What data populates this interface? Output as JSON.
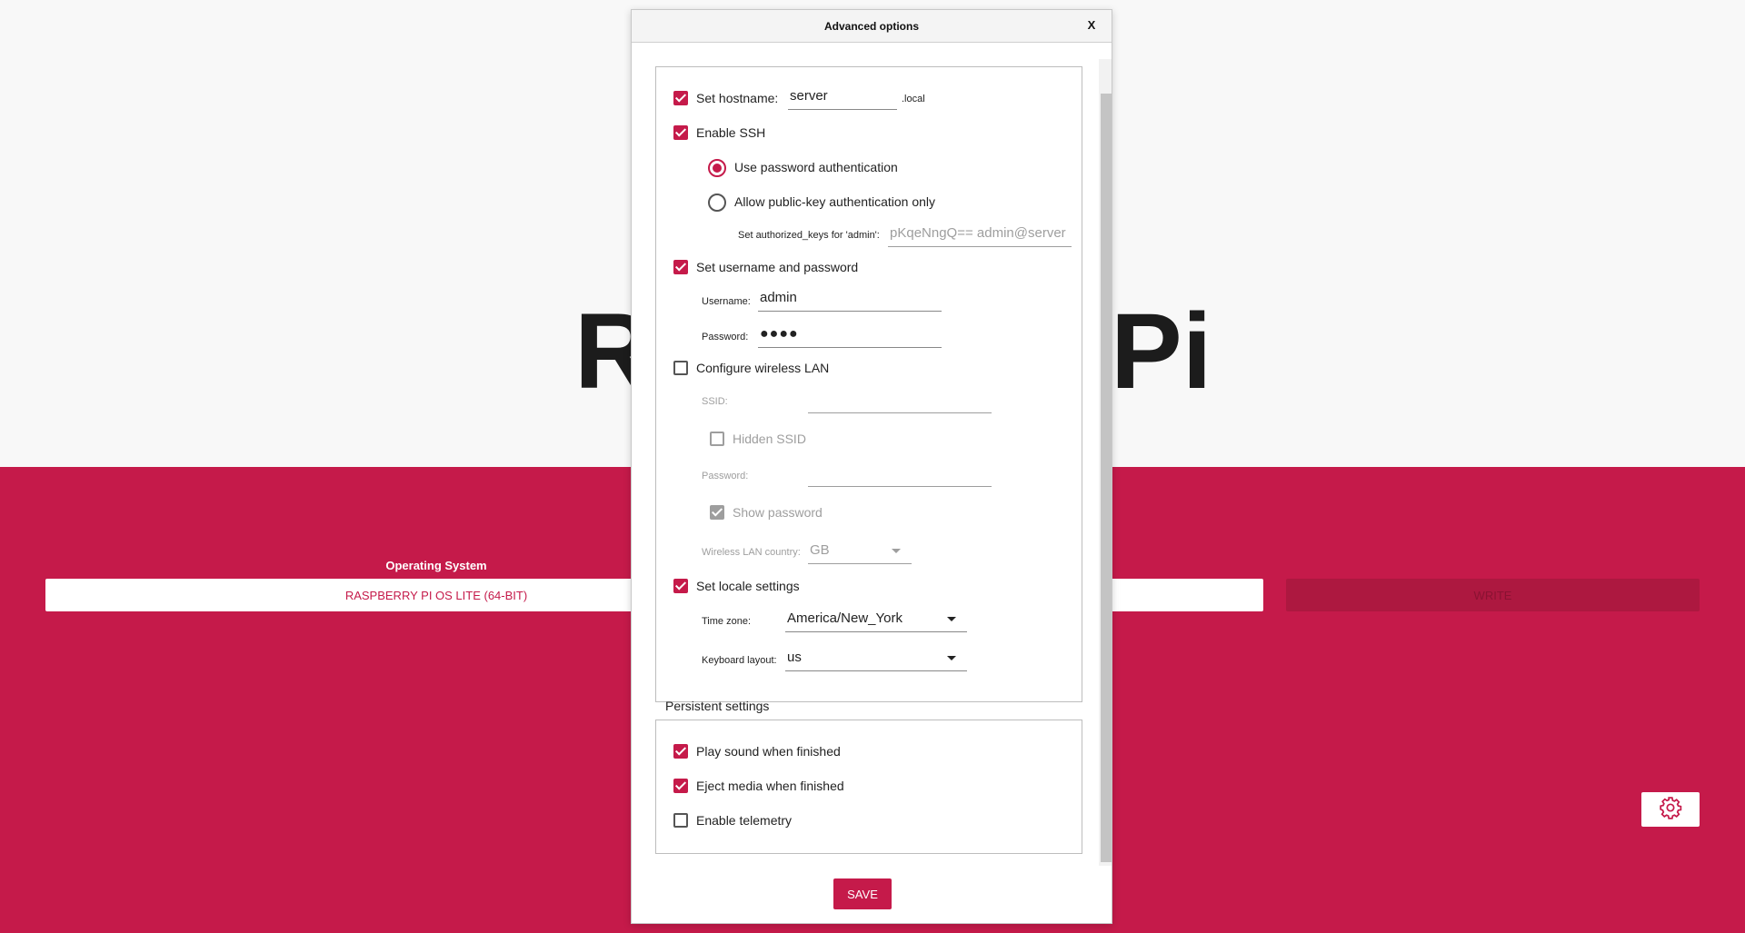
{
  "background": {
    "title_left": "R",
    "title_right": "Pi",
    "os_label": "Operating System",
    "os_button": "RASPBERRY PI OS LITE (64-BIT)",
    "write_button": "WRITE",
    "settings_icon": "gear-icon",
    "colors": {
      "brand": "#c51a4a",
      "brand_dark": "#ad1840"
    }
  },
  "dialog": {
    "title": "Advanced options",
    "close_label": "X",
    "hostname": {
      "label": "Set hostname:",
      "value": "server",
      "suffix": ".local",
      "checked": true
    },
    "ssh": {
      "label": "Enable SSH",
      "checked": true,
      "password_auth_label": "Use password authentication",
      "password_auth_selected": true,
      "pubkey_label": "Allow public-key authentication only",
      "pubkey_selected": false,
      "authorized_keys_label": "Set authorized_keys for 'admin':",
      "authorized_keys_value": "pKqeNngQ== admin@server"
    },
    "user": {
      "label": "Set username and password",
      "checked": true,
      "username_label": "Username:",
      "username_value": "admin",
      "password_label": "Password:",
      "password_value": "●●●●"
    },
    "wifi": {
      "label": "Configure wireless LAN",
      "checked": false,
      "ssid_label": "SSID:",
      "ssid_value": "",
      "hidden_ssid_label": "Hidden SSID",
      "hidden_ssid_checked": false,
      "password_label": "Password:",
      "password_value": "",
      "show_password_label": "Show password",
      "show_password_checked": true,
      "country_label": "Wireless LAN country:",
      "country_value": "GB"
    },
    "locale": {
      "label": "Set locale settings",
      "checked": true,
      "timezone_label": "Time zone:",
      "timezone_value": "America/New_York",
      "keyboard_label": "Keyboard layout:",
      "keyboard_value": "us"
    },
    "persistent": {
      "title": "Persistent settings",
      "play_sound_label": "Play sound when finished",
      "play_sound_checked": true,
      "eject_label": "Eject media when finished",
      "eject_checked": true,
      "telemetry_label": "Enable telemetry",
      "telemetry_checked": false
    },
    "save_label": "SAVE"
  }
}
